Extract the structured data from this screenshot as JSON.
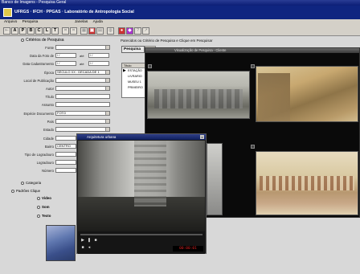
{
  "window": {
    "title": "Banco de Imagens - Pesquisa Geral"
  },
  "app": {
    "header": "UFRGS  ·  IFCH  ·  PPGAS  ·  Laboratório de Antropologia Social"
  },
  "menu": {
    "items": [
      "Arquivo",
      "Pesquisa"
    ],
    "right_items": [
      "Janelas",
      "Ajuda"
    ]
  },
  "toolbar": {
    "buttons": [
      "A",
      "P",
      "B",
      "C",
      "L",
      "T",
      "",
      "",
      "",
      "",
      "",
      "",
      "",
      "",
      "",
      ""
    ]
  },
  "criteria": {
    "title": "Critérios de Pesquisa",
    "fields": [
      {
        "label": "Fonte",
        "value": ""
      },
      {
        "label": "Data da Foto de",
        "value": "/ /",
        "until_label": "até",
        "until_value": "/ /"
      },
      {
        "label": "Data Cadastramento",
        "value": "/ /",
        "until_label": "até",
        "until_value": "/ /"
      },
      {
        "label": "Época",
        "value": "SÉCULO XX : DÉCADA DE 1"
      },
      {
        "label": "Local de Publicação",
        "value": ""
      },
      {
        "label": "Autor",
        "value": ""
      },
      {
        "label": "Título",
        "value": ""
      },
      {
        "label": "Assunto",
        "value": ""
      },
      {
        "label": "Espécie Documento",
        "value": "FOTO"
      },
      {
        "label": "País",
        "value": ""
      },
      {
        "label": "Estado",
        "value": ""
      },
      {
        "label": "Cidade",
        "value": ""
      },
      {
        "label": "Bairro",
        "value": "CENTRO"
      },
      {
        "label": "Tipo de Logradouro",
        "value": ""
      },
      {
        "label": "Logradouro",
        "value": ""
      },
      {
        "label": "Número",
        "value": ""
      }
    ],
    "categoria_label": "Categoria",
    "patterns_label": "Padrões Clique",
    "pattern_options": [
      "Video",
      "Som",
      "Texto"
    ]
  },
  "results": {
    "header": "Parecidos ou Critério de Pesquisa e Clique em Pesquisar",
    "tab_label": "Pesquisa",
    "list_header": "Título",
    "rows": [
      "ESTAÇÃO",
      "LIVRARIO",
      "MUSEU 1",
      "PRIMEIRO"
    ]
  },
  "photo_window": {
    "title": "Visualização de Pesquisa - Cliente"
  },
  "video_window": {
    "title": "Arquitetura urbana",
    "close": "x",
    "time": "00:00:01"
  },
  "colors": {
    "title_blue": "#0f2580",
    "window_bg": "#d8d8d8",
    "video_time": "#d22222"
  }
}
